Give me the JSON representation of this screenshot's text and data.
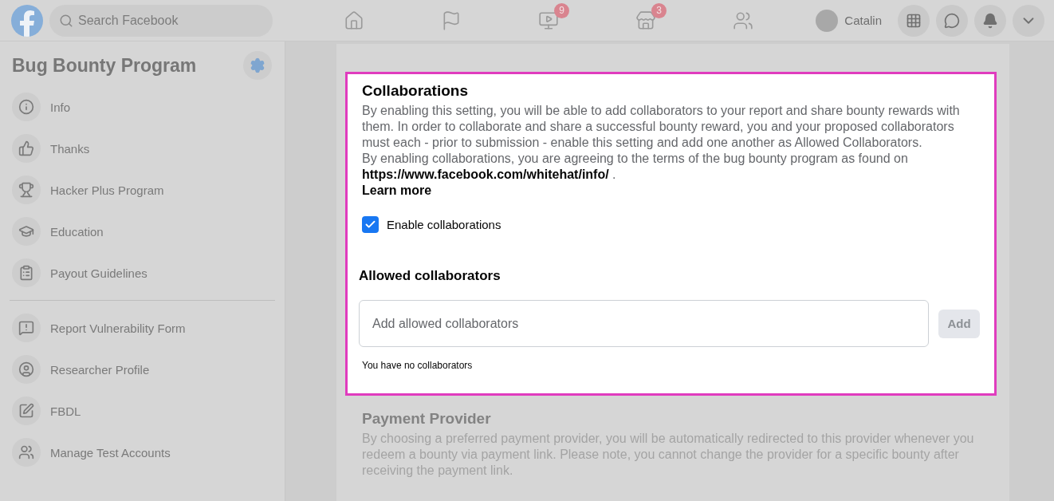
{
  "topbar": {
    "search": {
      "placeholder": "Search Facebook"
    },
    "nav": [
      {
        "kind": "home"
      },
      {
        "kind": "flag"
      },
      {
        "kind": "video",
        "badge": "9"
      },
      {
        "kind": "store",
        "badge": "3"
      },
      {
        "kind": "groups"
      }
    ],
    "user": {
      "name": "Catalin"
    }
  },
  "sidebar": {
    "title": "Bug Bounty Program",
    "groups": [
      [
        {
          "label": "Info"
        },
        {
          "label": "Thanks"
        },
        {
          "label": "Hacker Plus Program"
        },
        {
          "label": "Education"
        },
        {
          "label": "Payout Guidelines"
        }
      ],
      [
        {
          "label": "Report Vulnerability Form"
        },
        {
          "label": "Researcher Profile"
        },
        {
          "label": "FBDL"
        },
        {
          "label": "Manage Test Accounts"
        }
      ]
    ]
  },
  "collaborations": {
    "title": "Collaborations",
    "description": "By enabling this setting, you will be able to add collaborators to your report and share bounty rewards with them. In order to collaborate and share a successful bounty reward, you and your proposed collaborators must each - prior to submission - enable this setting and add one another as Allowed Collaborators.",
    "terms_before": "By enabling collaborations, you are agreeing to the terms of the bug bounty program as found on",
    "terms_link": "https://www.facebook.com/whitehat/info/",
    "terms_after": ".",
    "learn_more": "Learn more",
    "checkbox": {
      "label": "Enable collaborations",
      "checked": true
    },
    "allowed_title": "Allowed collaborators",
    "input": {
      "placeholder": "Add allowed collaborators"
    },
    "add_button": {
      "label": "Add",
      "disabled": true
    },
    "empty_note": "You have no collaborators"
  },
  "payment": {
    "title": "Payment Provider",
    "description": "By choosing a preferred payment provider, you will be automatically redirected to this provider whenever you redeem a bounty via payment link. Please note, you cannot change the provider for a specific bounty after receiving the payment link."
  }
}
